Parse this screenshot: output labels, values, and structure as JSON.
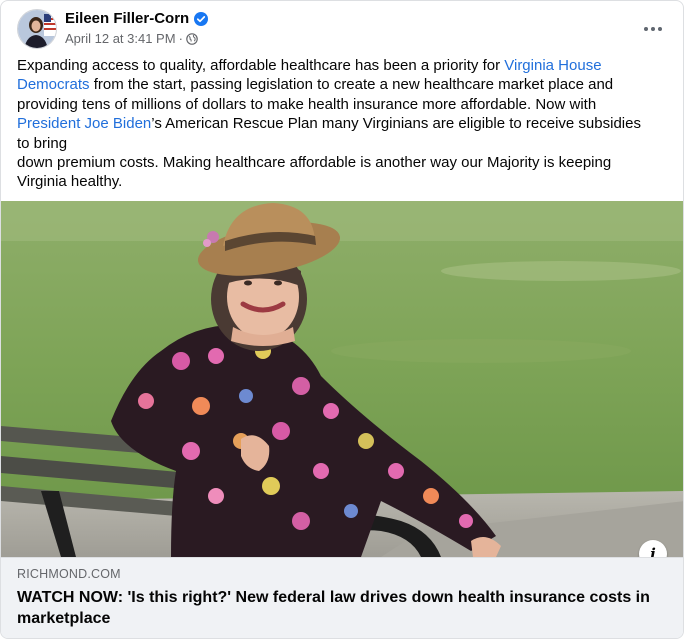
{
  "post": {
    "author": "Eileen Filler-Corn",
    "timestamp": "April 12 at 3:41 PM",
    "separator": "·",
    "privacy_icon": "globe-icon",
    "verified_icon": "verified-badge-icon",
    "more_icon": "more-options-icon",
    "text": {
      "p1_part1": "Expanding access to quality, affordable healthcare has been a priority for ",
      "p1_link1": "Virginia House Democrats",
      "p1_part2": " from the start, passing legislation to create a new healthcare market place and providing tens of millions of dollars to make health insurance more affordable. Now with ",
      "p1_link2": "President Joe Biden",
      "p1_part3": "’s American Rescue Plan many Virginians are eligible to receive subsidies to bring",
      "p2": "down premium costs. Making healthcare affordable is another way our Majority is keeping Virginia healthy."
    }
  },
  "link_preview": {
    "domain": "RICHMOND.COM",
    "title": "WATCH NOW: 'Is this right?' New federal law drives down health insurance costs in marketplace",
    "info_label": "i"
  },
  "colors": {
    "link": "#216fdb",
    "secondary_text": "#65676b",
    "verified": "#1877f2",
    "preview_bg": "#f0f2f5"
  }
}
